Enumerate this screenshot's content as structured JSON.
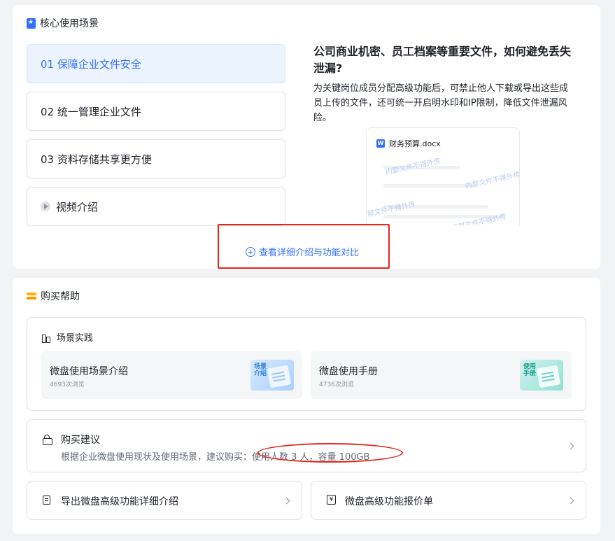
{
  "core": {
    "title": "核心使用场景",
    "items": [
      {
        "label": "01  保障企业文件安全"
      },
      {
        "label": "02  统一管理企业文件"
      },
      {
        "label": "03  资料存储共享更方便"
      },
      {
        "label": "视频介绍"
      }
    ],
    "detail_title": "公司商业机密、员工档案等重要文件，如何避免丢失泄漏?",
    "detail_desc": "为关键岗位成员分配高级功能后，可禁止他人下载或导出这些成员上传的文件，还可统一开启明水印和IP限制，降低文件泄漏风险。",
    "preview_file": "财务预算.docx",
    "preview_file_badge": "W",
    "watermark": "内部文件不得外传",
    "detail_link": "查看详细介绍与功能对比"
  },
  "help": {
    "title": "购买帮助",
    "practice_title": "场景实践",
    "tiles": [
      {
        "title": "微盘使用场景介绍",
        "views": "4693次浏览",
        "badge": "场景介绍"
      },
      {
        "title": "微盘使用手册",
        "views": "4736次浏览",
        "badge": "使用手册"
      }
    ],
    "advice_title": "购买建议",
    "advice_desc": "根据企业微盘使用现状及使用场景，建议购买：使用人数 3 人，容量 100GB",
    "export_label": "导出微盘高级功能详细介绍",
    "quote_label": "微盘高级功能报价单",
    "quote_icon": "¥"
  },
  "colors": {
    "accent": "#3370ff",
    "highlight": "#e5241a"
  }
}
